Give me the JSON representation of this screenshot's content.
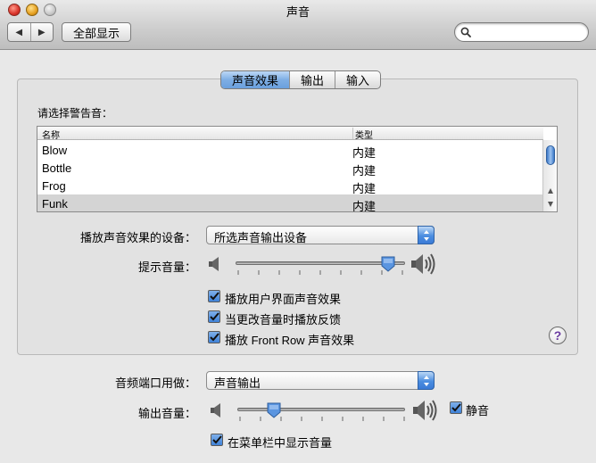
{
  "window": {
    "title": "声音"
  },
  "toolbar": {
    "back_glyph": "◀",
    "forward_glyph": "▶",
    "show_all_label": "全部显示",
    "search_value": ""
  },
  "tabs": [
    {
      "label": "声音效果",
      "active": true
    },
    {
      "label": "输出",
      "active": false
    },
    {
      "label": "输入",
      "active": false
    }
  ],
  "sound_effects": {
    "alert_label": "请选择警告音：",
    "columns": {
      "name": "名称",
      "type": "类型"
    },
    "rows": [
      {
        "name": "Blow",
        "type": "内建",
        "selected": false
      },
      {
        "name": "Bottle",
        "type": "内建",
        "selected": false
      },
      {
        "name": "Frog",
        "type": "内建",
        "selected": false
      },
      {
        "name": "Funk",
        "type": "内建",
        "selected": true
      }
    ],
    "device_label": "播放声音效果的设备：",
    "device_value": "所选声音输出设备",
    "alert_volume_label": "提示音量：",
    "alert_volume_level": 0.9,
    "checkboxes": [
      {
        "label": "播放用户界面声音效果",
        "checked": true
      },
      {
        "label": "当更改音量时播放反馈",
        "checked": true
      },
      {
        "label": "播放 Front Row 声音效果",
        "checked": true
      }
    ],
    "help_glyph": "?"
  },
  "output": {
    "port_label": "音频端口用做：",
    "port_value": "声音输出",
    "volume_label": "输出音量：",
    "volume_level": 0.22,
    "mute_label": "静音",
    "mute_checked": true,
    "menubar_label": "在菜单栏中显示音量",
    "menubar_checked": true
  },
  "colors": {
    "accent_blue": "#4b8de0",
    "selected_row": "#d4d4d4",
    "help_purple": "#6a3ba0"
  },
  "icons": [
    "back-icon",
    "forward-icon",
    "search-icon",
    "speaker-low-icon",
    "speaker-high-icon",
    "checkmark-icon",
    "help-icon",
    "popup-arrows-icon"
  ]
}
